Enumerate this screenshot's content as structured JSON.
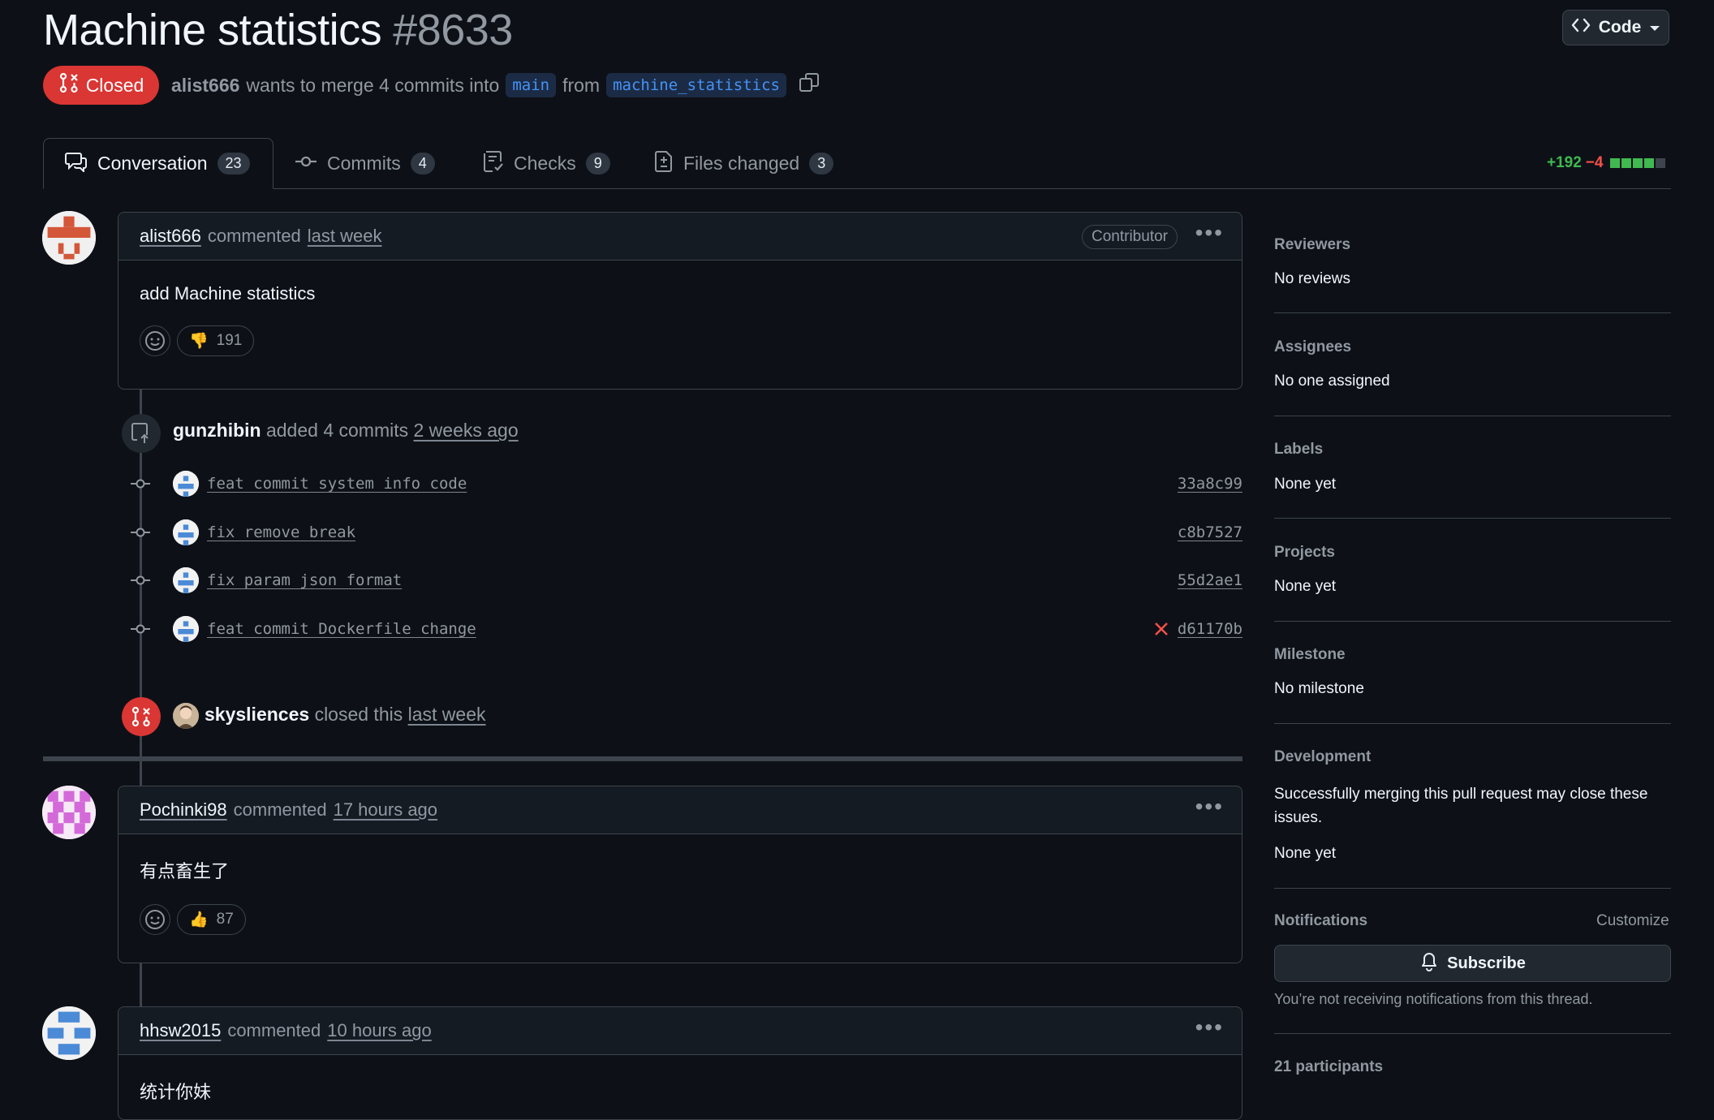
{
  "header": {
    "title": "Machine statistics",
    "number": "#8633",
    "code_button": "Code",
    "state": "Closed",
    "author": "alist666",
    "merge_text": "wants to merge 4 commits into",
    "base_branch": "main",
    "from_text": "from",
    "head_branch": "machine_statistics"
  },
  "tabs": [
    {
      "label": "Conversation",
      "count": "23",
      "icon": "comment-discussion-icon"
    },
    {
      "label": "Commits",
      "count": "4",
      "icon": "git-commit-icon"
    },
    {
      "label": "Checks",
      "count": "9",
      "icon": "checklist-icon"
    },
    {
      "label": "Files changed",
      "count": "3",
      "icon": "file-diff-icon"
    }
  ],
  "diffstat": {
    "additions": "+192",
    "deletions": "−4"
  },
  "comments": [
    {
      "author": "alist666",
      "action": "commented",
      "time": "last week",
      "badge": "Contributor",
      "body": "add Machine statistics",
      "reaction_emoji": "👎",
      "reaction_count": "191"
    },
    {
      "author": "Pochinki98",
      "action": "commented",
      "time": "17 hours ago",
      "body": "有点畜生了",
      "reaction_emoji": "👍",
      "reaction_count": "87"
    },
    {
      "author": "hhsw2015",
      "action": "commented",
      "time": "10 hours ago",
      "body": "统计你妹"
    }
  ],
  "commit_event": {
    "author": "gunzhibin",
    "action": "added 4 commits",
    "time": "2 weeks ago",
    "commits": [
      {
        "message": "feat commit system info code",
        "sha": "33a8c99"
      },
      {
        "message": "fix remove break",
        "sha": "c8b7527"
      },
      {
        "message": "fix param json format",
        "sha": "55d2ae1"
      },
      {
        "message": "feat commit Dockerfile change",
        "sha": "d61170b",
        "status": "failed"
      }
    ]
  },
  "close_event": {
    "author": "skysliences",
    "action": "closed this",
    "time": "last week"
  },
  "sidebar": {
    "reviewers": {
      "label": "Reviewers",
      "value": "No reviews"
    },
    "assignees": {
      "label": "Assignees",
      "value": "No one assigned"
    },
    "labels": {
      "label": "Labels",
      "value": "None yet"
    },
    "projects": {
      "label": "Projects",
      "value": "None yet"
    },
    "milestone": {
      "label": "Milestone",
      "value": "No milestone"
    },
    "development": {
      "label": "Development",
      "text": "Successfully merging this pull request may close these issues.",
      "value": "None yet"
    },
    "notifications": {
      "label": "Notifications",
      "customize": "Customize",
      "subscribe": "Subscribe",
      "note": "You’re not receiving notifications from this thread."
    },
    "participants": "21 participants"
  },
  "colors": {
    "closed": "#da3633",
    "link": "#4493f8",
    "add": "#3fb950",
    "del": "#f85149",
    "bg": "#0d1117"
  }
}
